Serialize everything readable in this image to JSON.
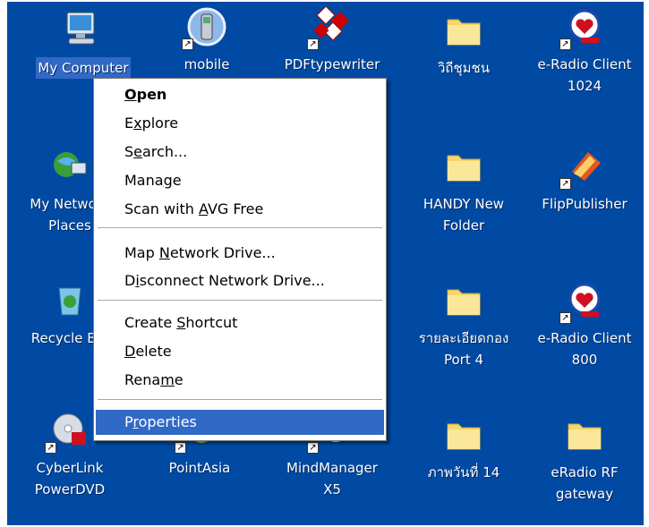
{
  "desktop": {
    "icons": [
      {
        "label": "My Computer",
        "selected": true
      },
      {
        "label": "mobile"
      },
      {
        "label": "PDFtypewriter"
      },
      {
        "label": "วิถีชุมชน"
      },
      {
        "label": "e-Radio Client\n1024"
      },
      {
        "label": "My Network\nPlaces"
      },
      {
        "label": "HANDY New\nFolder"
      },
      {
        "label": "FlipPublisher"
      },
      {
        "label": "Recycle Bin"
      },
      {
        "label": "รายละเอียดกอง\nPort 4"
      },
      {
        "label": "e-Radio Client\n800"
      },
      {
        "label": "CyberLink\nPowerDVD"
      },
      {
        "label": "PointAsia"
      },
      {
        "label": "MindManager\nX5"
      },
      {
        "label": "ภาพวันที่ 14"
      },
      {
        "label": "eRadio RF\ngateway"
      }
    ]
  },
  "context_menu": {
    "items": [
      {
        "label": "Open",
        "mnemonic": "O"
      },
      {
        "label": "Explore",
        "mnemonic": "x"
      },
      {
        "label": "Search...",
        "mnemonic": "e"
      },
      {
        "label": "Manage",
        "mnemonic": "g"
      },
      {
        "label": "Scan with AVG Free",
        "mnemonic": "A"
      },
      {
        "label": "Map Network Drive...",
        "mnemonic": "N"
      },
      {
        "label": "Disconnect Network Drive...",
        "mnemonic": "i"
      },
      {
        "label": "Create Shortcut",
        "mnemonic": "S"
      },
      {
        "label": "Delete",
        "mnemonic": "D"
      },
      {
        "label": "Rename",
        "mnemonic": "m"
      },
      {
        "label": "Properties",
        "mnemonic": "r"
      }
    ],
    "highlighted": "Properties"
  },
  "colors": {
    "desktop_background": "#004aa3",
    "selection_highlight": "#3169c6",
    "folder_yellow": "#f5d76e"
  },
  "icon_names": [
    "my-computer-icon",
    "mobile-phone-icon",
    "pdf-typewriter-icon",
    "folder-icon",
    "e-radio-icon",
    "network-places-icon",
    "folder-icon",
    "flip-publisher-icon",
    "recycle-bin-icon",
    "folder-icon",
    "e-radio-icon",
    "cyberlink-dvd-icon",
    "pointasia-icon",
    "mindmanager-icon",
    "folder-icon",
    "folder-icon"
  ]
}
